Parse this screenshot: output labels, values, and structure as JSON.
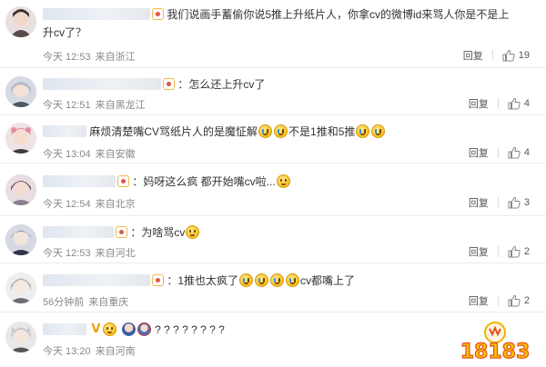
{
  "comments": [
    {
      "name_width": 118,
      "text": "我们说画手蓄偷你说5推上升纸片人，你拿cv的微博id来骂人你是不是上",
      "text2": "升cv了？",
      "time": "今天 12:53",
      "location": "来自浙江",
      "reply": "回复",
      "likes": "19"
    },
    {
      "name_width": 130,
      "text": "：怎么还上升cv了",
      "time": "今天 12:51",
      "location": "来自黑龙江",
      "reply": "回复",
      "likes": "4"
    },
    {
      "name_width": 48,
      "text": "麻烦清楚嘴CV骂纸片人的是魔怔解",
      "text_mid": "不是1推和5推",
      "time": "今天 13:04",
      "location": "来自安徽",
      "reply": "回复",
      "likes": "4"
    },
    {
      "name_width": 80,
      "text": "：妈呀这么疯 都开始嘴cv啦...",
      "time": "今天 12:54",
      "location": "来自北京",
      "reply": "回复",
      "likes": "3"
    },
    {
      "name_width": 78,
      "text": "：为啥骂cv",
      "time": "今天 12:53",
      "location": "来自河北",
      "reply": "回复",
      "likes": "2"
    },
    {
      "name_width": 118,
      "text": "：1推也太疯了",
      "text_end": "cv都嘴上了",
      "time": "56分钟前",
      "location": "来自重庆",
      "reply": "回复",
      "likes": "2"
    },
    {
      "name_width": 48,
      "text": "? ? ? ? ? ? ? ?",
      "time": "今天 13:20",
      "location": "来自河南",
      "reply": "回复",
      "likes": ""
    }
  ],
  "watermark": {
    "text": "18183"
  },
  "colors": {
    "like_icon": "#888888",
    "divider": "#ececec"
  },
  "icons": {
    "like": "thumbs-up-icon"
  }
}
